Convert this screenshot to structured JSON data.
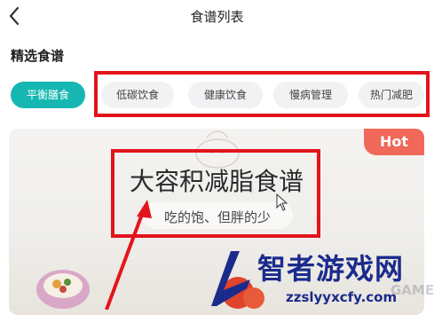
{
  "header": {
    "title": "食谱列表"
  },
  "section": {
    "title": "精选食谱"
  },
  "tabs": [
    {
      "label": "平衡膳食",
      "active": true
    },
    {
      "label": "低碳饮食",
      "active": false
    },
    {
      "label": "健康饮食",
      "active": false
    },
    {
      "label": "慢病管理",
      "active": false
    },
    {
      "label": "热门减肥",
      "active": false
    }
  ],
  "banner": {
    "badge": "Hot",
    "title": "大容积减脂食谱",
    "subtitle": "吃的饱、但胖的少"
  },
  "watermark": {
    "brand": "智者游戏网",
    "url": "zzslyyxcfy.com",
    "faint": "GAME"
  },
  "colors": {
    "accent": "#16b7b2",
    "annotation_red": "#e3141c",
    "hot_badge": "#f0685a",
    "watermark_blue": "#1b2b8c"
  }
}
